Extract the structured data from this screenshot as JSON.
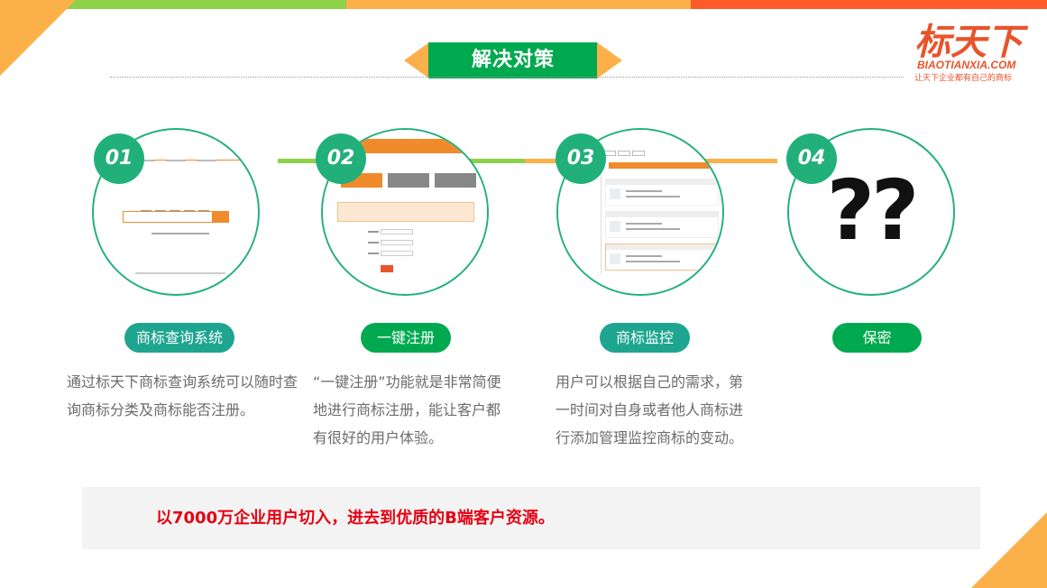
{
  "title": "解决对策",
  "logo": {
    "main": "标天下",
    "english": "BIAOTIANXIA.COM",
    "slogan": "让天下企业都有自己的商标"
  },
  "steps": [
    {
      "number": "01",
      "label": "商标查询系统",
      "description": "通过标天下商标查询系统可以随时查询商标分类及商标能否注册。",
      "icon": "trademark-search-screenshot"
    },
    {
      "number": "02",
      "label": "一键注册",
      "description": "“一键注册”功能就是非常简便地进行商标注册，能让客户都有很好的用户体验。",
      "icon": "one-click-register-screenshot"
    },
    {
      "number": "03",
      "label": "商标监控",
      "description": "用户可以根据自己的需求，第一时间对自身或者他人商标进行添加管理监控商标的变动。",
      "icon": "trademark-monitor-screenshot"
    },
    {
      "number": "04",
      "label": "保密",
      "content": "??",
      "icon": "question-marks"
    }
  ],
  "bottom": {
    "text": "以7000万企业用户切入，进去到优质的B端客户资源。"
  },
  "colors": {
    "green": "#00a94f",
    "teal": "#1ea58f",
    "orange": "#fbb04a",
    "red": "#ff5a2a",
    "lime": "#8dd14b",
    "highlight": "#e60012"
  }
}
